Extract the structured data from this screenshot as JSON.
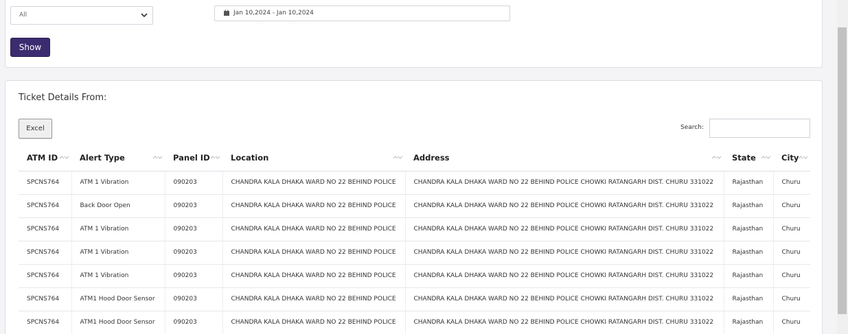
{
  "filters": {
    "select_value": "All",
    "date_range": "Jan 10,2024 - Jan 10,2024",
    "show_label": "Show"
  },
  "tickets": {
    "title": "Ticket Details From:",
    "excel_label": "Excel",
    "search_label": "Search:",
    "search_value": ""
  },
  "table": {
    "columns": [
      "ATM ID",
      "Alert Type",
      "Panel ID",
      "Location",
      "Address",
      "State",
      "City"
    ],
    "rows": [
      [
        "SPCNS764",
        "ATM 1 Vibration",
        "090203",
        "CHANDRA KALA DHAKA WARD NO 22 BEHIND POLICE",
        "CHANDRA KALA DHAKA WARD NO 22 BEHIND POLICE CHOWKI RATANGARH DIST. CHURU 331022",
        "Rajasthan",
        "Churu"
      ],
      [
        "SPCNS764",
        "Back Door Open",
        "090203",
        "CHANDRA KALA DHAKA WARD NO 22 BEHIND POLICE",
        "CHANDRA KALA DHAKA WARD NO 22 BEHIND POLICE CHOWKI RATANGARH DIST. CHURU 331022",
        "Rajasthan",
        "Churu"
      ],
      [
        "SPCNS764",
        "ATM 1 Vibration",
        "090203",
        "CHANDRA KALA DHAKA WARD NO 22 BEHIND POLICE",
        "CHANDRA KALA DHAKA WARD NO 22 BEHIND POLICE CHOWKI RATANGARH DIST. CHURU 331022",
        "Rajasthan",
        "Churu"
      ],
      [
        "SPCNS764",
        "ATM 1 Vibration",
        "090203",
        "CHANDRA KALA DHAKA WARD NO 22 BEHIND POLICE",
        "CHANDRA KALA DHAKA WARD NO 22 BEHIND POLICE CHOWKI RATANGARH DIST. CHURU 331022",
        "Rajasthan",
        "Churu"
      ],
      [
        "SPCNS764",
        "ATM 1 Vibration",
        "090203",
        "CHANDRA KALA DHAKA WARD NO 22 BEHIND POLICE",
        "CHANDRA KALA DHAKA WARD NO 22 BEHIND POLICE CHOWKI RATANGARH DIST. CHURU 331022",
        "Rajasthan",
        "Churu"
      ],
      [
        "SPCNS764",
        "ATM1 Hood Door Sensor",
        "090203",
        "CHANDRA KALA DHAKA WARD NO 22 BEHIND POLICE",
        "CHANDRA KALA DHAKA WARD NO 22 BEHIND POLICE CHOWKI RATANGARH DIST. CHURU 331022",
        "Rajasthan",
        "Churu"
      ],
      [
        "SPCNS764",
        "ATM1 Hood Door Sensor",
        "090203",
        "CHANDRA KALA DHAKA WARD NO 22 BEHIND POLICE",
        "CHANDRA KALA DHAKA WARD NO 22 BEHIND POLICE CHOWKI RATANGARH DIST. CHURU 331022",
        "Rajasthan",
        "Churu"
      ]
    ]
  },
  "colors": {
    "primary_button": "#3b2c70",
    "page_background": "#f4f4f6"
  }
}
